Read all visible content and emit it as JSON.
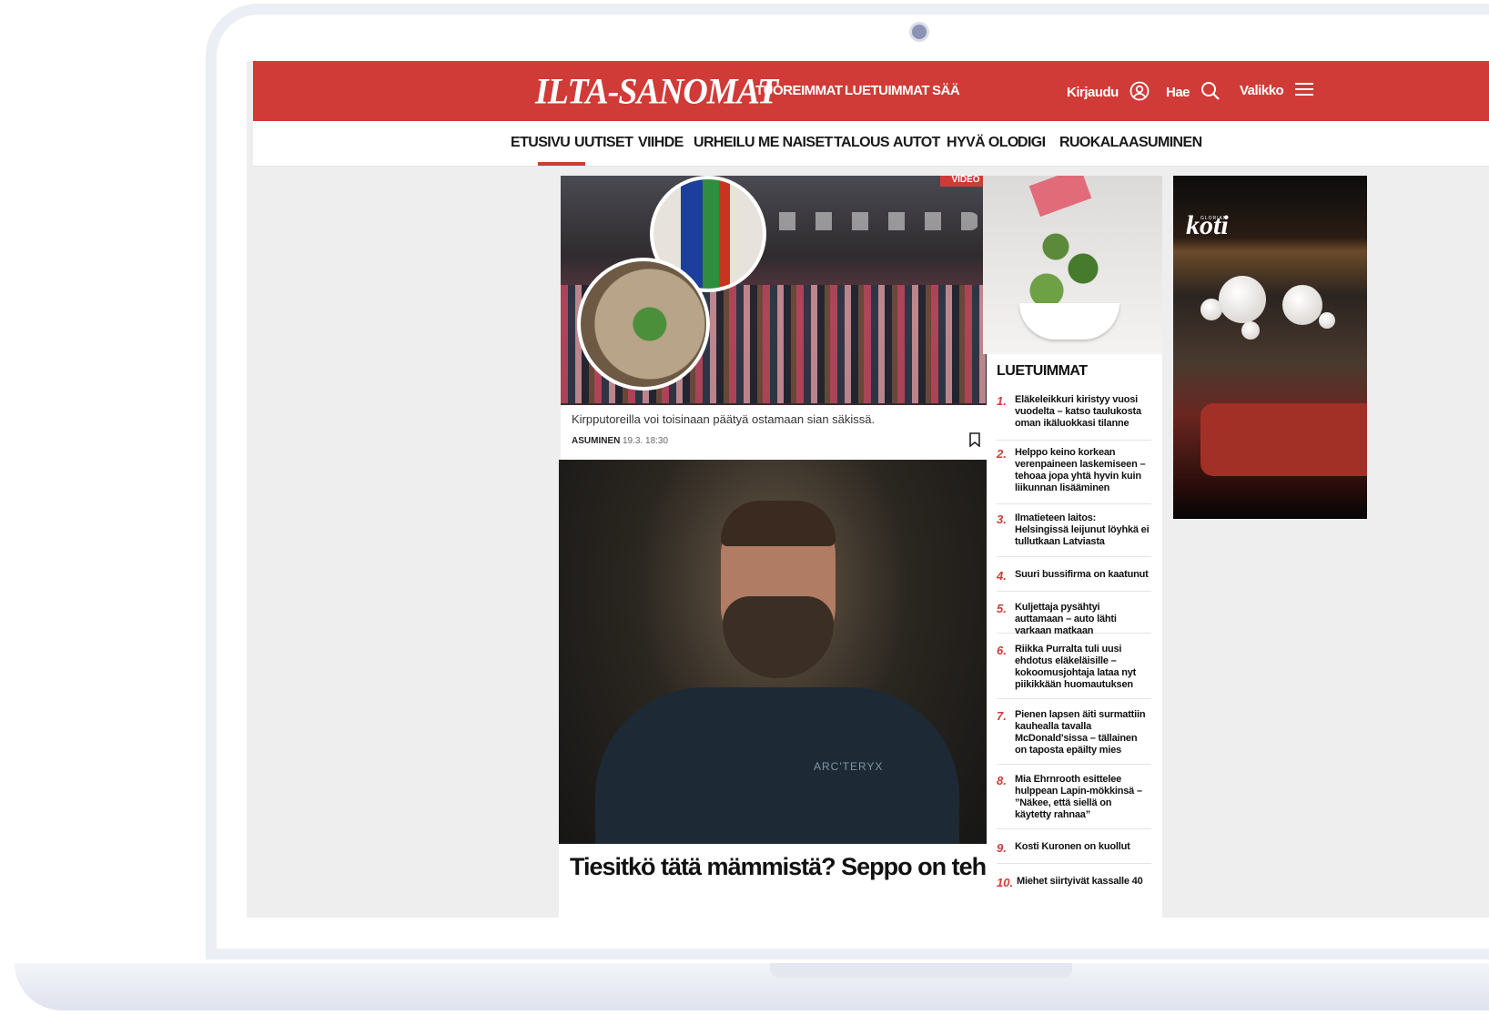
{
  "site": {
    "logo": "ILTA-SANOMAT",
    "top_nav": [
      "TUOREIMMAT",
      "LUETUIMMAT",
      "SÄÄ"
    ],
    "login_label": "Kirjaudu",
    "search_label": "Hae",
    "menu_label": "Valikko",
    "accent_color": "#d03b37"
  },
  "section_nav": {
    "items": [
      "ETUSIVU",
      "UUTISET",
      "VIIHDE",
      "URHEILU",
      "ME NAISET",
      "TALOUS",
      "AUTOT",
      "HYVÄ OLO",
      "DIGI",
      "RUOKALA",
      "ASUMINEN"
    ],
    "active": "ETUSIVU"
  },
  "card1": {
    "tag": "VIDEO",
    "caption": "Kirpputoreilla voi toisinaan päätyä ostamaan sian säkissä.",
    "category": "ASUMINEN",
    "time": "19.3. 18:30"
  },
  "card2": {
    "headline": "Tiesitkö tätä mämmistä? Seppo on tehnyt",
    "jacket_brand": "ARC'TERYX"
  },
  "most_read": {
    "title": "LUETUIMMAT",
    "items": [
      {
        "num": "1.",
        "text": "Eläkeleikkuri kiristyy vuosi vuodelta – katso taulukosta oman ikäluokkasi tilanne"
      },
      {
        "num": "2.",
        "text": "Helppo keino korkean verenpaineen laskemiseen – tehoaa jopa yhtä hyvin kuin liikunnan lisääminen"
      },
      {
        "num": "3.",
        "text": "Ilmatieteen laitos: Helsingissä leijunut löyhkä ei tullutkaan Latviasta"
      },
      {
        "num": "4.",
        "text": "Suuri bussifirma on kaatunut"
      },
      {
        "num": "5.",
        "text": "Kuljettaja pysähtyi auttamaan – auto lähti varkaan matkaan"
      },
      {
        "num": "6.",
        "text": "Riikka Purralta tuli uusi ehdotus eläkeläisille – kokoomusjohtaja lataa nyt piikikkään huomautuksen"
      },
      {
        "num": "7.",
        "text": "Pienen lapsen äiti surmattiin kauhealla tavalla McDonald'sissa – tällainen on taposta epäilty mies"
      },
      {
        "num": "8.",
        "text": "Mia Ehrnrooth esittelee hulppean Lapin-mökkinsä – ”Näkee, että siellä on käytetty rahnaa”"
      },
      {
        "num": "9.",
        "text": "Kosti Kuronen on kuollut"
      },
      {
        "num": "10.",
        "text": "Miehet siirtyivät kassalle 40"
      }
    ]
  },
  "ad": {
    "brand_small": "GLORIAN",
    "brand": "koti"
  }
}
